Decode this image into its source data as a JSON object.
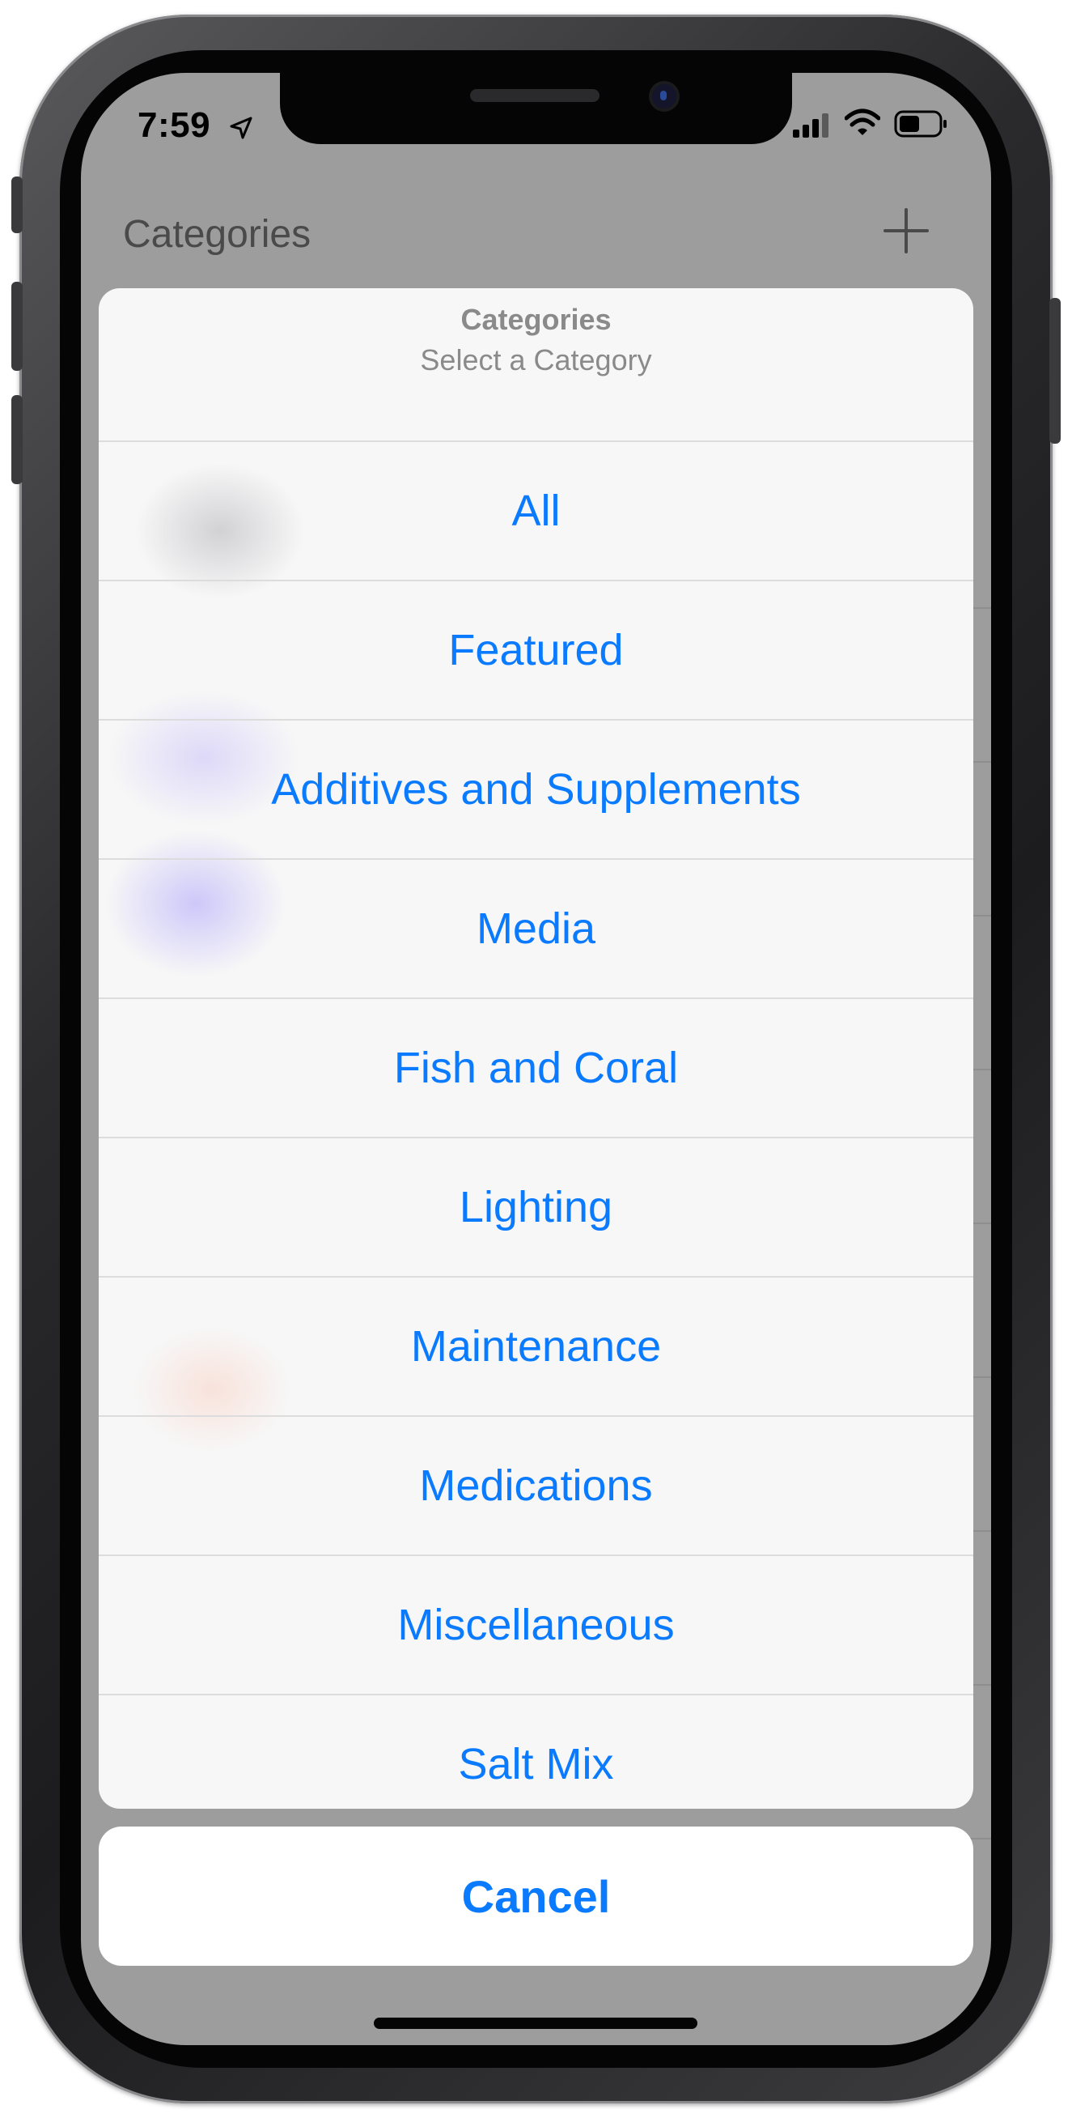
{
  "status_bar": {
    "time": "7:59",
    "icons": [
      "location-arrow-icon",
      "cellular-signal-icon",
      "wifi-icon",
      "battery-icon"
    ]
  },
  "nav": {
    "title": "Categories",
    "add_icon": "plus-icon"
  },
  "action_sheet": {
    "title": "Categories",
    "subtitle": "Select a Category",
    "options": [
      "All",
      "Featured",
      "Additives and Supplements",
      "Media",
      "Fish and Coral",
      "Lighting",
      "Maintenance",
      "Medications",
      "Miscellaneous",
      "Salt Mix"
    ],
    "cancel_label": "Cancel"
  },
  "colors": {
    "accent": "#0a7aff",
    "dim_overlay": "#9d9d9d",
    "sheet_background": "#f7f7f7"
  }
}
